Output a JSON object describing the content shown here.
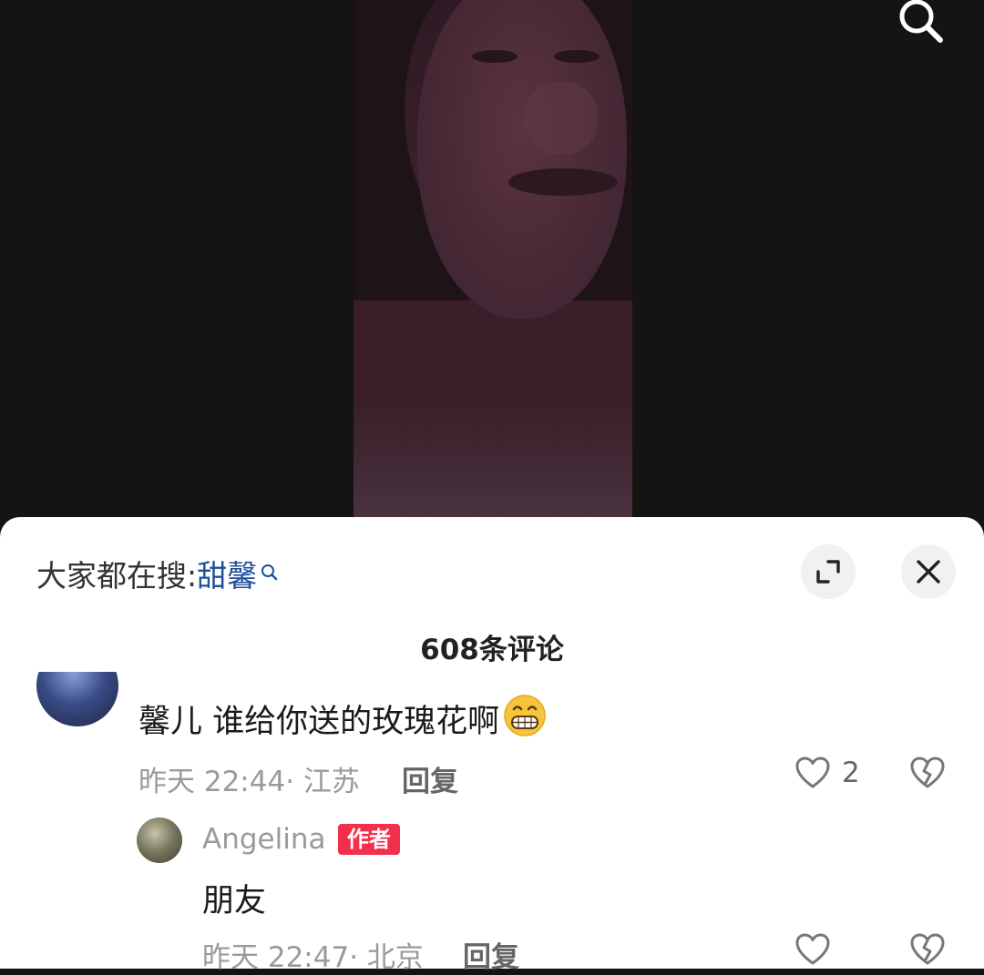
{
  "top_bar": {
    "search_icon": "search-icon"
  },
  "panel": {
    "hot_search_prefix": "大家都在搜:",
    "hot_search_term": "甜馨",
    "comment_count_label": "608条评论",
    "expand_icon": "expand-icon",
    "close_icon": "close-icon"
  },
  "comments": [
    {
      "text": "馨儿 谁给你送的玫瑰花啊",
      "emoji": "grin-emoji",
      "time": "昨天 22:44",
      "location": "· 江苏",
      "reply_label": "回复",
      "like_count": "2",
      "replies": [
        {
          "name": "Angelina",
          "badge": "作者",
          "text": "朋友",
          "time": "昨天 22:47",
          "location": "· 北京",
          "reply_label": "回复"
        }
      ]
    }
  ],
  "colors": {
    "background": "#141212",
    "panel": "#ffffff",
    "hot_term": "#1e4f9a",
    "author_badge": "#f2304c",
    "meta_text": "#9a9a9a"
  }
}
